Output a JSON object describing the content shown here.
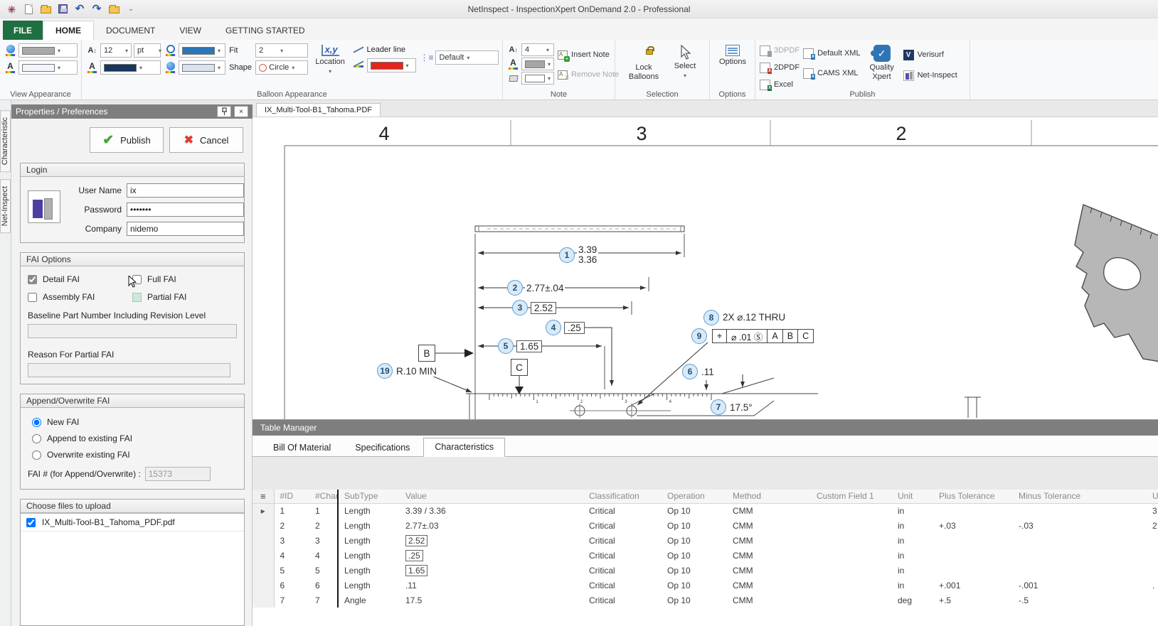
{
  "titlebar": {
    "title": "NetInspect - InspectionXpert OnDemand 2.0 - Professional"
  },
  "tabs": [
    {
      "label": "FILE"
    },
    {
      "label": "HOME"
    },
    {
      "label": "DOCUMENT"
    },
    {
      "label": "VIEW"
    },
    {
      "label": "GETTING STARTED"
    }
  ],
  "ribbon": {
    "groups": {
      "view_appearance": "View Appearance",
      "balloon_appearance": "Balloon Appearance",
      "note": "Note",
      "selection": "Selection",
      "options": "Options",
      "publish": "Publish"
    },
    "font_size": "12",
    "font_unit": "pt",
    "fit_label": "Fit",
    "fit_value": "2",
    "shape_label": "Shape",
    "shape_value": "Circle",
    "location": "Location",
    "leader_line": "Leader line",
    "style_value": "Default",
    "note_font_size": "4",
    "insert_note": "Insert Note",
    "remove_note": "Remove Note",
    "lock_balloons": "Lock Balloons",
    "select": "Select",
    "options_btn": "Options",
    "pdf3d": "3DPDF",
    "pdf2d": "2DPDF",
    "excel": "Excel",
    "default_xml": "Default XML",
    "cams_xml": "CAMS XML",
    "quality_xpert": "Quality Xpert",
    "verisurf": "Verisurf",
    "net_inspect": "Net-Inspect"
  },
  "colors": {
    "file_tab_green": "#1e6f41",
    "view_balloon_fill": "#a9a9a9",
    "view_text_fill": "#f2f5fb",
    "font_color": "#17365d",
    "balloon_border_color": "#2e75b6",
    "balloon_fill_color": "#d9e2ef",
    "leader_line_red": "#e4251b",
    "note_font_color": "#a6a6a6",
    "note_fill_color": "#ffffff",
    "drawing_balloon_fill": "#d9eaf7",
    "drawing_balloon_border": "#5b9bd5",
    "publish_check_green": "#3faa35",
    "cancel_x_red": "#e03c31"
  },
  "icons": {
    "pin": "⊤",
    "close": "×",
    "menu": "≡",
    "row_marker": "▸",
    "check": "✔",
    "cross": "✖",
    "undo": "↶",
    "redo": "↷",
    "cursor": "select-cursor"
  },
  "side_tabs": [
    {
      "label": "Characteristic"
    },
    {
      "label": "Net-Inspect"
    }
  ],
  "panel": {
    "title": "Properties / Preferences",
    "publish_button": "Publish",
    "cancel_button": "Cancel",
    "login": {
      "title": "Login",
      "user_label": "User Name",
      "user_value": "ix",
      "pass_label": "Password",
      "pass_value": "•••••••",
      "company_label": "Company",
      "company_value": "nidemo"
    },
    "fai_options": {
      "title": "FAI Options",
      "detail": "Detail FAI",
      "full": "Full FAI",
      "assembly": "Assembly FAI",
      "partial": "Partial FAI",
      "detail_checked": true,
      "assembly_checked": false,
      "baseline_label": "Baseline Part Number Including Revision Level",
      "baseline_value": "",
      "reason_label": "Reason For Partial FAI",
      "reason_value": ""
    },
    "append": {
      "title": "Append/Overwrite FAI",
      "new_fai": "New FAI",
      "append_fai": "Append to existing FAI",
      "overwrite_fai": "Overwrite existing FAI",
      "new_selected": true,
      "fai_label": "FAI # (for Append/Overwrite) :",
      "fai_value": "15373"
    },
    "files": {
      "title": "Choose files to upload",
      "file_name": "IX_Multi-Tool-B1_Tahoma_PDF.pdf",
      "file_checked": true
    }
  },
  "document": {
    "tab": "IX_Multi-Tool-B1_Tahoma.PDF",
    "zones": [
      "4",
      "3",
      "2"
    ],
    "datums": [
      "B",
      "C"
    ],
    "ruler_numbers": [
      "1",
      "2",
      "3",
      "4"
    ],
    "balloons": [
      {
        "num": "1",
        "label": "3.39",
        "label2": "3.36"
      },
      {
        "num": "2",
        "label": "2.77±.04"
      },
      {
        "num": "3",
        "label": "2.52",
        "boxed": true
      },
      {
        "num": "4",
        "label": ".25",
        "boxed": true
      },
      {
        "num": "5",
        "label": "1.65",
        "boxed": true
      },
      {
        "num": "19",
        "label": "R.10 MIN"
      },
      {
        "num": "8",
        "label": "2X ⌀.12 THRU"
      },
      {
        "num": "9",
        "fcf": [
          "⌖",
          "⌀ .01 Ⓢ",
          "A",
          "B",
          "C"
        ]
      },
      {
        "num": "6",
        "label": ".11"
      },
      {
        "num": "7",
        "label": "17.5°"
      }
    ]
  },
  "table_manager": {
    "title": "Table Manager",
    "tabs": [
      "Bill Of Material",
      "Specifications",
      "Characteristics"
    ],
    "active_tab": "Characteristics",
    "columns": [
      "#ID",
      "#Char",
      "SubType",
      "Value",
      "Classification",
      "Operation",
      "Method",
      "Custom Field 1",
      "Unit",
      "Plus Tolerance",
      "Minus Tolerance",
      "U"
    ],
    "rows": [
      {
        "id": "1",
        "char": "1",
        "subtype": "Length",
        "value": "3.39 / 3.36",
        "boxed": false,
        "classification": "Critical",
        "operation": "Op 10",
        "method": "CMM",
        "custom_field_1": "",
        "unit": "in",
        "plus_tolerance": "",
        "minus_tolerance": "",
        "u": "3"
      },
      {
        "id": "2",
        "char": "2",
        "subtype": "Length",
        "value": "2.77±.03",
        "boxed": false,
        "classification": "Critical",
        "operation": "Op 10",
        "method": "CMM",
        "custom_field_1": "",
        "unit": "in",
        "plus_tolerance": "+.03",
        "minus_tolerance": "-.03",
        "u": "2"
      },
      {
        "id": "3",
        "char": "3",
        "subtype": "Length",
        "value": "2.52",
        "boxed": true,
        "classification": "Critical",
        "operation": "Op 10",
        "method": "CMM",
        "custom_field_1": "",
        "unit": "in",
        "plus_tolerance": "",
        "minus_tolerance": "",
        "u": ""
      },
      {
        "id": "4",
        "char": "4",
        "subtype": "Length",
        "value": ".25",
        "boxed": true,
        "classification": "Critical",
        "operation": "Op 10",
        "method": "CMM",
        "custom_field_1": "",
        "unit": "in",
        "plus_tolerance": "",
        "minus_tolerance": "",
        "u": ""
      },
      {
        "id": "5",
        "char": "5",
        "subtype": "Length",
        "value": "1.65",
        "boxed": true,
        "classification": "Critical",
        "operation": "Op 10",
        "method": "CMM",
        "custom_field_1": "",
        "unit": "in",
        "plus_tolerance": "",
        "minus_tolerance": "",
        "u": ""
      },
      {
        "id": "6",
        "char": "6",
        "subtype": "Length",
        "value": ".11",
        "boxed": false,
        "classification": "Critical",
        "operation": "Op 10",
        "method": "CMM",
        "custom_field_1": "",
        "unit": "in",
        "plus_tolerance": "+.001",
        "minus_tolerance": "-.001",
        "u": "."
      },
      {
        "id": "7",
        "char": "7",
        "subtype": "Angle",
        "value": "17.5",
        "boxed": false,
        "classification": "Critical",
        "operation": "Op 10",
        "method": "CMM",
        "custom_field_1": "",
        "unit": "deg",
        "plus_tolerance": "+.5",
        "minus_tolerance": "-.5",
        "u": ""
      }
    ]
  }
}
